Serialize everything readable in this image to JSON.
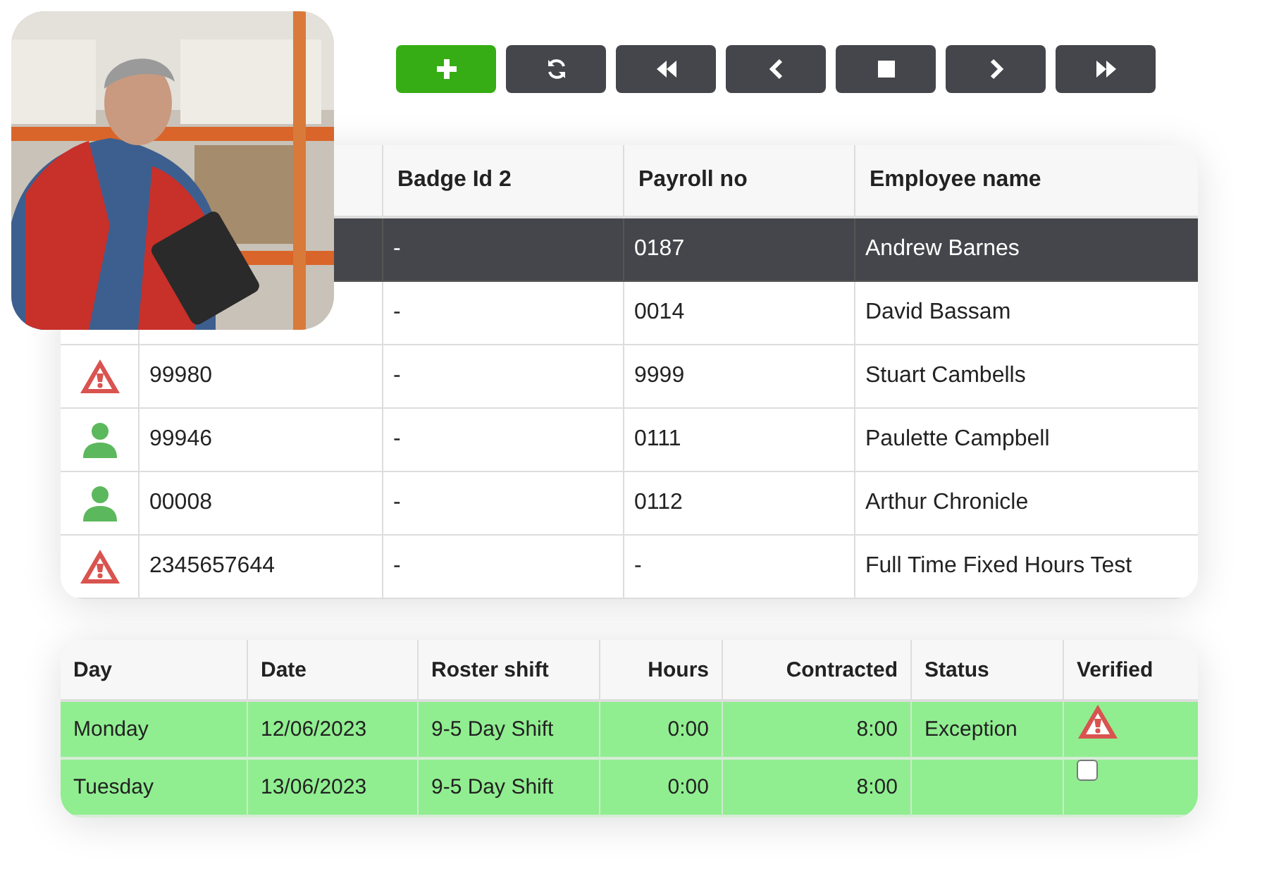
{
  "toolbar": [
    {
      "kind": "plus",
      "primary": true
    },
    {
      "kind": "refresh",
      "primary": false
    },
    {
      "kind": "first",
      "primary": false
    },
    {
      "kind": "previous",
      "primary": false
    },
    {
      "kind": "stop",
      "primary": false
    },
    {
      "kind": "next",
      "primary": false
    },
    {
      "kind": "last",
      "primary": false
    }
  ],
  "employees": {
    "columns": [
      "Badge Id 2",
      "Payroll no",
      "Employee name"
    ],
    "rows": [
      {
        "badge_id_2": "-",
        "payroll_no": "0187",
        "name": "Andrew Barnes",
        "selected": true
      },
      {
        "badge_id_2": "-",
        "payroll_no": "0014",
        "name": "David Bassam",
        "selected": false
      },
      {
        "kind": "warning",
        "badge_id": "99980",
        "badge_id_2": "-",
        "payroll_no": "9999",
        "name": "Stuart Cambells",
        "selected": false
      },
      {
        "kind": "person",
        "badge_id": "99946",
        "badge_id_2": "-",
        "payroll_no": "0111",
        "name": "Paulette Campbell",
        "selected": false
      },
      {
        "kind": "person",
        "badge_id": "00008",
        "badge_id_2": "-",
        "payroll_no": "0112",
        "name": "Arthur Chronicle",
        "selected": false
      },
      {
        "kind": "warning",
        "badge_id": "2345657644",
        "badge_id_2": "-",
        "payroll_no": "-",
        "name": "Full Time Fixed Hours Test",
        "selected": false
      }
    ]
  },
  "roster": {
    "columns": [
      "Day",
      "Date",
      "Roster shift",
      "Hours",
      "Contracted",
      "Status",
      "Verified"
    ],
    "rows": [
      {
        "day": "Monday",
        "date": "12/06/2023",
        "roster_shift": "9-5 Day Shift",
        "hours": "0:00",
        "contracted": "8:00",
        "status": "Exception",
        "verified": {
          "kind": "warning"
        }
      },
      {
        "day": "Tuesday",
        "date": "13/06/2023",
        "roster_shift": "9-5 Day Shift",
        "hours": "0:00",
        "contracted": "8:00",
        "verified": {
          "kind": "checkbox",
          "checked": false
        }
      }
    ]
  }
}
